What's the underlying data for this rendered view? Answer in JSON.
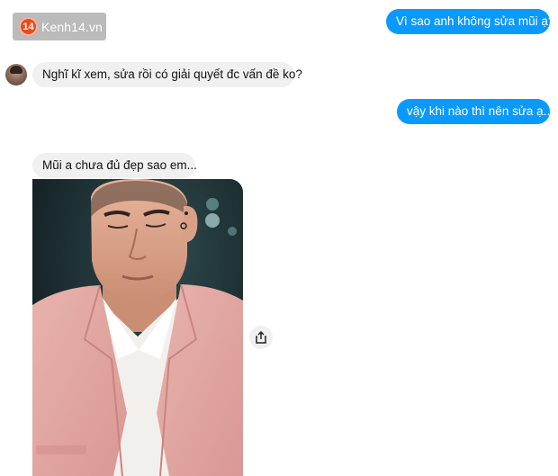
{
  "watermark": {
    "badge": "14",
    "text": "Kenh14.vn"
  },
  "messages": [
    {
      "direction": "outgoing",
      "text": "Vì sao anh không sửa mũi ạ?"
    },
    {
      "direction": "incoming",
      "text": "Nghĩ kĩ xem, sửa rồi có giải quyết đc vấn đề ko?"
    },
    {
      "direction": "outgoing",
      "text": "vậy khi nào thì nên sửa ạ..."
    },
    {
      "direction": "incoming",
      "text": "Mũi a chưa đủ đẹp sao em..."
    }
  ],
  "photo": {
    "icon": "photo-of-man-in-pink-blazer"
  },
  "share": {
    "icon": "share-icon"
  },
  "colors": {
    "outgoing_bubble": "#0a99ff",
    "incoming_bubble": "#f0f0f0",
    "blazer": "#e2a9a4"
  }
}
